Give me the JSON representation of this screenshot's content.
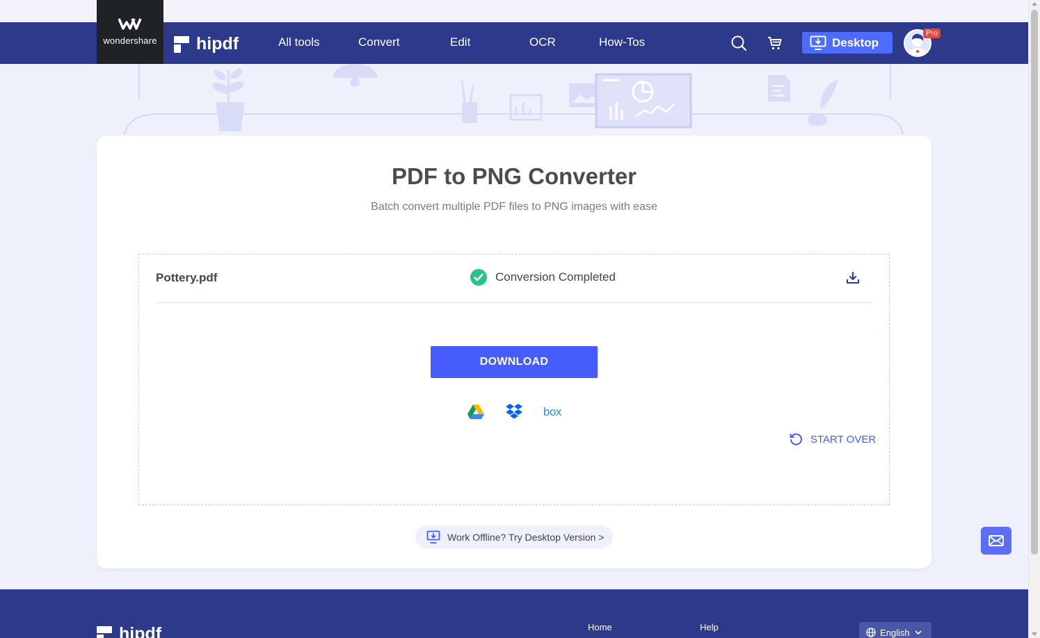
{
  "brand": {
    "parent": "wondershare",
    "product": "hipdf"
  },
  "nav": {
    "items": [
      "All tools",
      "Convert",
      "Edit",
      "OCR",
      "How-Tos"
    ],
    "desktop_label": "Desktop",
    "pro_badge": "Pro"
  },
  "main": {
    "title": "PDF to PNG Converter",
    "subtitle": "Batch convert multiple PDF files to PNG images with ease",
    "file": {
      "name": "Pottery.pdf",
      "status": "Conversion Completed"
    },
    "download_label": "DOWNLOAD",
    "cloud_services": [
      "google-drive-icon",
      "dropbox-icon",
      "box-icon"
    ],
    "box_label": "box",
    "start_over_label": "START OVER",
    "offline_label": "Work Offline? Try Desktop Version >"
  },
  "footer": {
    "logo": "hipdf",
    "links": [
      "Home",
      "Help"
    ],
    "language": "English"
  },
  "colors": {
    "nav_bg": "#2d3a8c",
    "accent": "#465cfb",
    "success": "#2bc28a",
    "page_bg": "#eef0fb"
  }
}
